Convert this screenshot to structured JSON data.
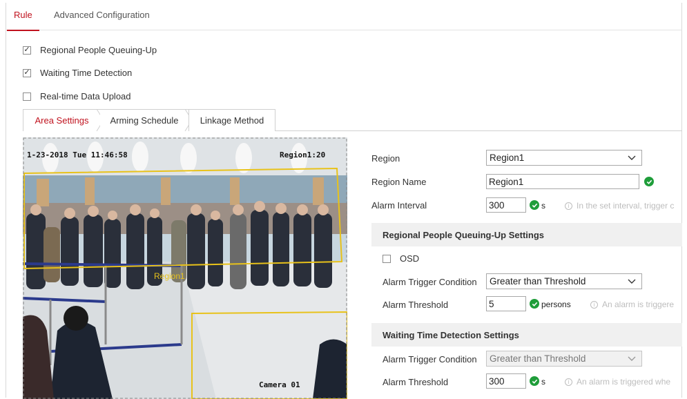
{
  "top_tabs": [
    {
      "label": "Rule",
      "active": true
    },
    {
      "label": "Advanced Configuration",
      "active": false
    }
  ],
  "options": [
    {
      "label": "Regional People Queuing-Up",
      "checked": true
    },
    {
      "label": "Waiting Time Detection",
      "checked": true
    },
    {
      "label": "Real-time Data Upload",
      "checked": false
    }
  ],
  "sub_tabs": [
    {
      "label": "Area Settings",
      "active": true
    },
    {
      "label": "Arming Schedule",
      "active": false
    },
    {
      "label": "Linkage Method",
      "active": false
    }
  ],
  "video": {
    "timestamp": "1-23-2018 Tue 11:46:58",
    "region_counter": "Region1:20",
    "region_label": "Region1",
    "camera_name": "Camera 01"
  },
  "form": {
    "region_label": "Region",
    "region_value": "Region1",
    "region_name_label": "Region Name",
    "region_name_value": "Region1",
    "alarm_interval_label": "Alarm Interval",
    "alarm_interval_value": "300",
    "alarm_interval_unit": "s",
    "alarm_interval_hint": "In the set interval, trigger c"
  },
  "queue_section": {
    "title": "Regional People Queuing-Up Settings",
    "osd_label": "OSD",
    "osd_checked": false,
    "trigger_label": "Alarm Trigger Condition",
    "trigger_value": "Greater than Threshold",
    "threshold_label": "Alarm Threshold",
    "threshold_value": "5",
    "threshold_unit": "persons",
    "threshold_hint": "An alarm is triggere"
  },
  "wait_section": {
    "title": "Waiting Time Detection Settings",
    "trigger_label": "Alarm Trigger Condition",
    "trigger_value": "Greater than Threshold",
    "threshold_label": "Alarm Threshold",
    "threshold_value": "300",
    "threshold_unit": "s",
    "threshold_hint": "An alarm is triggered whe"
  },
  "colors": {
    "accent": "#c0121e",
    "ok_green": "#1f9d3a",
    "region_yellow": "#e8c21a"
  }
}
